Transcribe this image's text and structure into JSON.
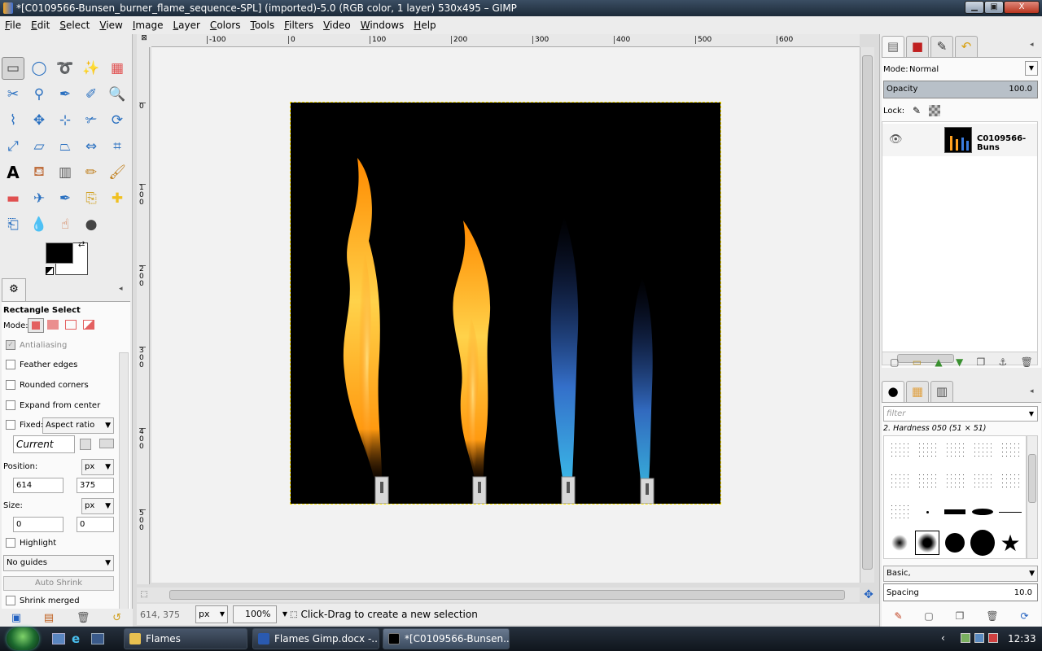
{
  "window": {
    "title": "*[C0109566-Bunsen_burner_flame_sequence-SPL] (imported)-5.0 (RGB color, 1 layer) 530x495 – GIMP",
    "minimize": "▁",
    "maximize": "▣",
    "close": "X"
  },
  "menu": [
    "File",
    "Edit",
    "Select",
    "View",
    "Image",
    "Layer",
    "Colors",
    "Tools",
    "Filters",
    "Video",
    "Windows",
    "Help"
  ],
  "toolbox": {
    "tools": [
      "rect-select",
      "ellipse-select",
      "free-select",
      "fuzzy-select",
      "by-color-select",
      "scissors-select",
      "foreground-select",
      "paths",
      "color-picker",
      "zoom",
      "measure",
      "move",
      "align",
      "crop",
      "rotate",
      "scale",
      "shear",
      "perspective",
      "flip",
      "cage",
      "text",
      "bucket-fill",
      "blend",
      "pencil",
      "paintbrush",
      "eraser",
      "airbrush",
      "ink",
      "clone",
      "heal",
      "perspective-clone",
      "blur",
      "smudge",
      "dodge-burn"
    ],
    "colors": {
      "foreground": "#000000",
      "background": "#ffffff"
    }
  },
  "tool_options": {
    "title": "Rectangle Select",
    "mode_label": "Mode:",
    "antialiasing": "Antialiasing",
    "feather": "Feather edges",
    "rounded": "Rounded corners",
    "expand": "Expand from center",
    "fixed": "Fixed:",
    "fixed_value": "Aspect ratio",
    "current": "Current",
    "position_label": "Position:",
    "position_unit": "px",
    "pos_x": "614",
    "pos_y": "375",
    "size_label": "Size:",
    "size_unit": "px",
    "size_w": "0",
    "size_h": "0",
    "highlight": "Highlight",
    "guides": "No guides",
    "auto_shrink": "Auto Shrink",
    "shrink_merged": "Shrink merged"
  },
  "ruler_top": [
    "-100",
    "0",
    "100",
    "200",
    "300",
    "400",
    "500",
    "600"
  ],
  "ruler_left": [
    "0",
    "100",
    "200",
    "300",
    "400",
    "500"
  ],
  "statusbar": {
    "coords": "614, 375",
    "unit": "px",
    "zoom": "100%",
    "message": "Click-Drag to create a new selection"
  },
  "layers": {
    "mode_label": "Mode:",
    "mode": "Normal",
    "opacity_label": "Opacity",
    "opacity": "100.0",
    "lock_label": "Lock:",
    "layer_name": "C0109566-Buns"
  },
  "brushes": {
    "filter_placeholder": "filter",
    "selected": "2. Hardness 050 (51 × 51)",
    "category": "Basic,",
    "spacing_label": "Spacing",
    "spacing": "10.0"
  },
  "taskbar": {
    "items": [
      "Flames",
      "Flames Gimp.docx -...",
      "*[C0109566-Bunsen..."
    ],
    "clock": "12:33"
  }
}
